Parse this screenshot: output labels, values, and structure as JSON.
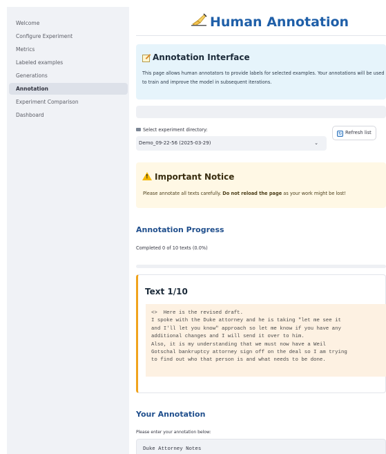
{
  "sidebar": {
    "items": [
      {
        "label": "Welcome",
        "active": false
      },
      {
        "label": "Configure Experiment",
        "active": false
      },
      {
        "label": "Metrics",
        "active": false
      },
      {
        "label": "Labeled examples",
        "active": false
      },
      {
        "label": "Generations",
        "active": false
      },
      {
        "label": "Annotation",
        "active": true
      },
      {
        "label": "Experiment Comparison",
        "active": false
      },
      {
        "label": "Dashboard",
        "active": false
      }
    ]
  },
  "header": {
    "icon": "writing-hand-icon",
    "title": "Human Annotation"
  },
  "info_box": {
    "icon": "memo-icon",
    "title": "Annotation Interface",
    "text": "This page allows human annotators to provide labels for selected examples. Your annotations will be used to train and improve the model in subsequent iterations."
  },
  "experiment_select": {
    "label": "Select experiment directory:",
    "value": "Demo_09-22-56 (2025-03-29)",
    "refresh_label": "Refresh list"
  },
  "notice": {
    "icon": "warning-icon",
    "title": "Important Notice",
    "text_before": "Please annotate all texts carefully. ",
    "text_bold": "Do not reload the page",
    "text_after": " as your work might be lost!"
  },
  "progress": {
    "title": "Annotation Progress",
    "text": "Completed 0 of 10 texts (0.0%)",
    "fraction": 0.0
  },
  "text_card": {
    "title": "Text 1/10",
    "body": "<>  Here is the revised draft.\nI spoke with the Duke attorney and he is taking \"let me see it\nand I'll let you know\" approach so let me know if you have any\nadditional changes and I will send it over to him.\nAlso, it is my understanding that we must now have a Weil\nGotschal bankruptcy attorney sign off on the deal so I am trying\nto find out who that person is and what needs to be done."
  },
  "annotation": {
    "title": "Your Annotation",
    "label": "Please enter your annotation below:",
    "value": "Duke Attorney Notes"
  },
  "colors": {
    "accent": "#1f5fa8",
    "info_bg": "#e6f4fb",
    "warning_bg": "#fff8e5",
    "card_border": "#f0a31c"
  }
}
